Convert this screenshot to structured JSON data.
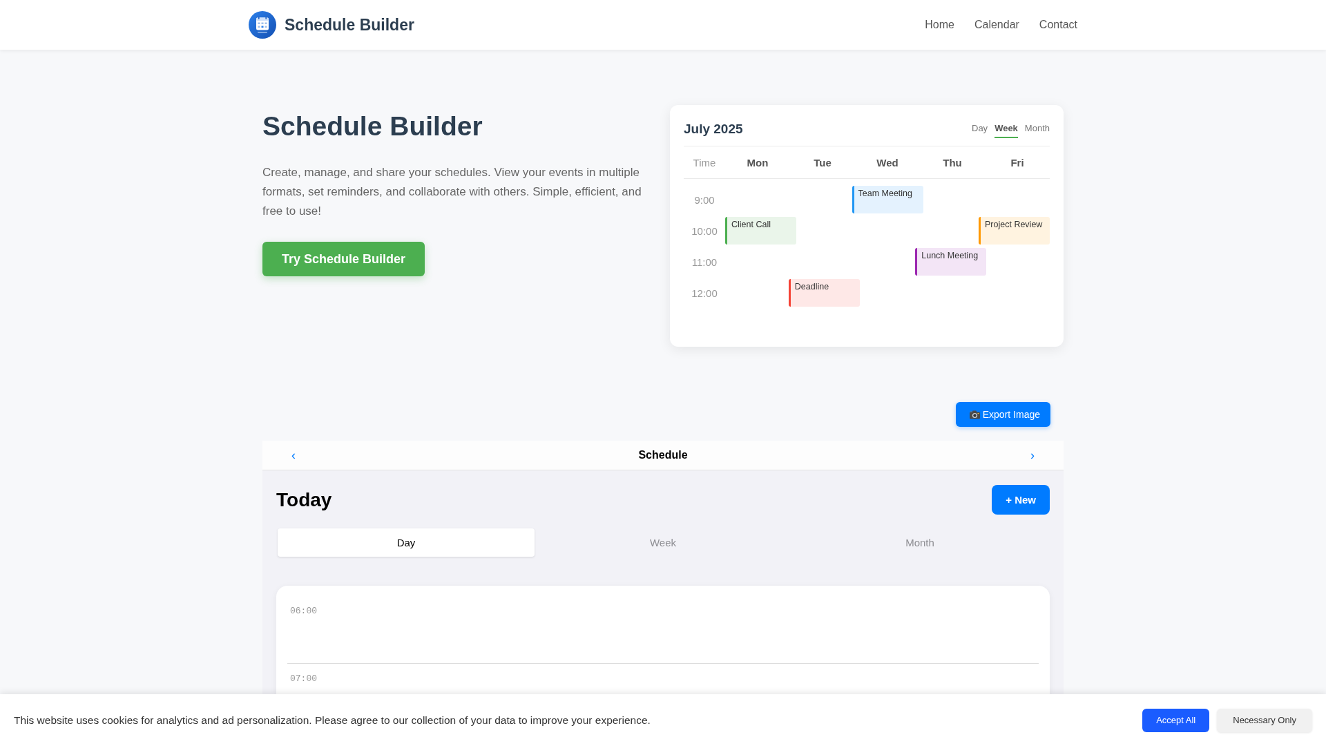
{
  "header": {
    "title": "Schedule Builder",
    "nav": [
      {
        "label": "Home"
      },
      {
        "label": "Calendar"
      },
      {
        "label": "Contact"
      }
    ]
  },
  "hero": {
    "title": "Schedule Builder",
    "description": "Create, manage, and share your schedules. View your events in multiple formats, set reminders, and collaborate with others. Simple, efficient, and free to use!",
    "cta": "Try Schedule Builder"
  },
  "preview_calendar": {
    "title": "July 2025",
    "views": [
      {
        "label": "Day",
        "selected": false
      },
      {
        "label": "Week",
        "selected": true
      },
      {
        "label": "Month",
        "selected": false
      }
    ],
    "time_heading": "Time",
    "days": [
      "Mon",
      "Tue",
      "Wed",
      "Thu",
      "Fri"
    ],
    "rows": [
      {
        "time": "9:00",
        "cells": [
          null,
          null,
          {
            "title": "Team Meeting",
            "color": "#2196f3"
          },
          null,
          null
        ]
      },
      {
        "time": "10:00",
        "cells": [
          {
            "title": "Client Call",
            "color": "#4caf50"
          },
          null,
          null,
          null,
          {
            "title": "Project Review",
            "color": "#ff9800"
          }
        ]
      },
      {
        "time": "11:00",
        "cells": [
          null,
          null,
          null,
          {
            "title": "Lunch Meeting",
            "color": "#9c27b0"
          },
          null
        ]
      },
      {
        "time": "12:00",
        "cells": [
          null,
          {
            "title": "Deadline",
            "color": "#f44336"
          },
          null,
          null,
          null
        ]
      }
    ]
  },
  "schedule": {
    "export_button": "Export Image",
    "prev": "‹",
    "title": "Schedule",
    "next": "›",
    "heading": "Today",
    "new_button": "+ New",
    "views": [
      {
        "label": "Day",
        "selected": true
      },
      {
        "label": "Week",
        "selected": false
      },
      {
        "label": "Month",
        "selected": false
      }
    ],
    "hours": [
      "06:00",
      "07:00"
    ]
  },
  "cookie_banner": {
    "message": "This website uses cookies for analytics and ad personalization. Please agree to our collection of your data to improve your experience.",
    "buttons": [
      {
        "label": "Accept All",
        "kind": "accept"
      },
      {
        "label": "Necessary Only",
        "kind": "necessary"
      }
    ]
  }
}
